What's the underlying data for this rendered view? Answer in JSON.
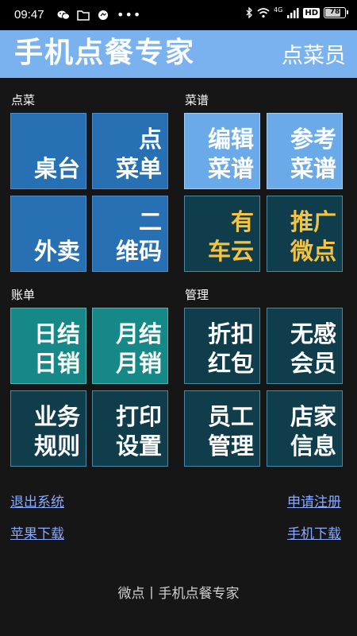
{
  "status_bar": {
    "time": "09:47",
    "network": "4G",
    "hd": "HD",
    "battery": "78",
    "battery_level": 0.78,
    "icons_left": [
      "wechat-icon",
      "folder-icon",
      "chat-bubble-icon",
      "more-dots-icon"
    ],
    "icons_right": [
      "bluetooth-icon",
      "wifi-icon",
      "signal-icon",
      "battery-icon"
    ]
  },
  "header": {
    "title": "手机点餐专家",
    "role": "点菜员",
    "background": "#7ab2f0"
  },
  "sections": {
    "order": {
      "label": "点菜",
      "tiles": [
        {
          "line1": "桌台",
          "line2": ""
        },
        {
          "line1": "点",
          "line2": "菜单"
        },
        {
          "line1": "外卖",
          "line2": ""
        },
        {
          "line1": "二",
          "line2": "维码"
        }
      ]
    },
    "menu": {
      "label": "菜谱",
      "tiles": [
        {
          "line1": "编辑",
          "line2": "菜谱"
        },
        {
          "line1": "参考",
          "line2": "菜谱"
        },
        {
          "line1": "有",
          "line2": "车云"
        },
        {
          "line1": "推广",
          "line2": "微点"
        }
      ]
    },
    "bill": {
      "label": "账单",
      "tiles": [
        {
          "line1": "日结",
          "line2": "日销"
        },
        {
          "line1": "月结",
          "line2": "月销"
        },
        {
          "line1": "业务",
          "line2": "规则"
        },
        {
          "line1": "打印",
          "line2": "设置"
        }
      ]
    },
    "manage": {
      "label": "管理",
      "tiles": [
        {
          "line1": "折扣",
          "line2": "红包"
        },
        {
          "line1": "无感",
          "line2": "会员"
        },
        {
          "line1": "员工",
          "line2": "管理"
        },
        {
          "line1": "店家",
          "line2": "信息"
        }
      ]
    }
  },
  "links": {
    "logout": "退出系统",
    "register": "申请注册",
    "apple_download": "苹果下载",
    "phone_download": "手机下载"
  },
  "footer": {
    "text": "微点丨手机点餐专家"
  },
  "colors": {
    "tile_blue": "#2670b3",
    "tile_light_blue": "#6aaae9",
    "tile_dark_teal": "#0f3d4b",
    "tile_teal": "#168888",
    "highlight_text": "#f5c344",
    "link": "#88a9ff"
  }
}
